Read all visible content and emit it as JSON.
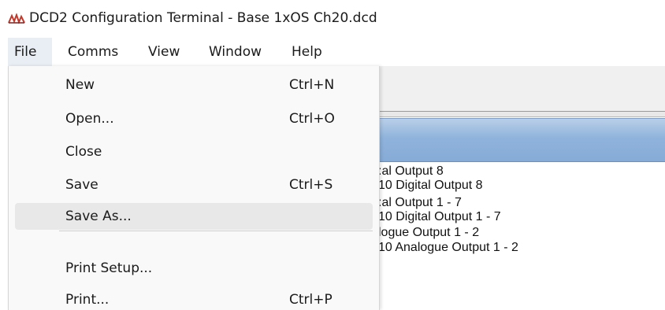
{
  "window": {
    "title": "DCD2 Configuration Terminal - Base 1xOS Ch20.dcd",
    "icon": "app-logo-icon"
  },
  "menubar": {
    "items": [
      {
        "label": "File",
        "open": true
      },
      {
        "label": "Comms"
      },
      {
        "label": "View"
      },
      {
        "label": "Window"
      },
      {
        "label": "Help"
      }
    ]
  },
  "file_menu": {
    "items": [
      {
        "label": "New",
        "shortcut": "Ctrl+N"
      },
      {
        "label": "Open...",
        "shortcut": "Ctrl+O"
      },
      {
        "label": "Close",
        "shortcut": ""
      },
      {
        "label": "Save",
        "shortcut": "Ctrl+S"
      },
      {
        "label": "Save As...",
        "shortcut": "",
        "highlighted": true
      },
      {
        "label": "Print Setup...",
        "shortcut": ""
      },
      {
        "label": "Print...",
        "shortcut": "Ctrl+P"
      }
    ]
  },
  "background_list": {
    "lines": [
      ":al Output 8",
      " 10 Digital Output 8",
      ":al Output 1 - 7",
      " 10 Digital Output 1 - 7",
      "logue Output 1 - 2",
      " 10 Analogue Output 1 - 2"
    ]
  },
  "colors": {
    "menu_open_bg": "#e9eef4",
    "hover_bg": "#e8e8e8",
    "header_blue": "#8fb3dc"
  }
}
